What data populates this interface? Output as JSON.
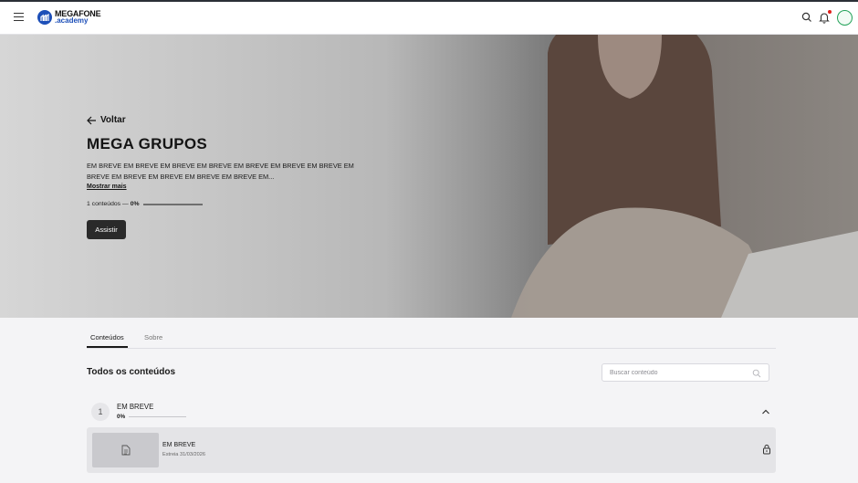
{
  "header": {
    "brand_top": "MEGAFONE",
    "brand_bottom": ".academy",
    "icons": [
      "menu-icon",
      "search-icon",
      "bell-icon",
      "avatar"
    ],
    "accent": "#1d4fb8"
  },
  "hero": {
    "back_label": "Voltar",
    "title": "MEGA GRUPOS",
    "description": "EM BREVE EM BREVE EM BREVE EM BREVE EM BREVE EM BREVE EM BREVE EM BREVE EM BREVE EM BREVE EM BREVE EM BREVE EM...",
    "show_more": "Mostrar mais",
    "content_count": "1 conteúdos —",
    "progress_label": "0%",
    "progress_value": 0,
    "watch_label": "Assistir"
  },
  "tabs": [
    {
      "label": "Conteúdos",
      "active": true
    },
    {
      "label": "Sobre",
      "active": false
    }
  ],
  "section": {
    "title": "Todos os conteúdos",
    "search_placeholder": "Buscar conteúdo"
  },
  "modules": [
    {
      "number": "1",
      "title": "EM BREVE",
      "progress_label": "0%",
      "progress_value": 0,
      "expanded": true,
      "lessons": [
        {
          "title": "EM BREVE",
          "date": "Estreia 31/03/2026",
          "locked": true,
          "icon": "document-icon"
        }
      ]
    }
  ]
}
